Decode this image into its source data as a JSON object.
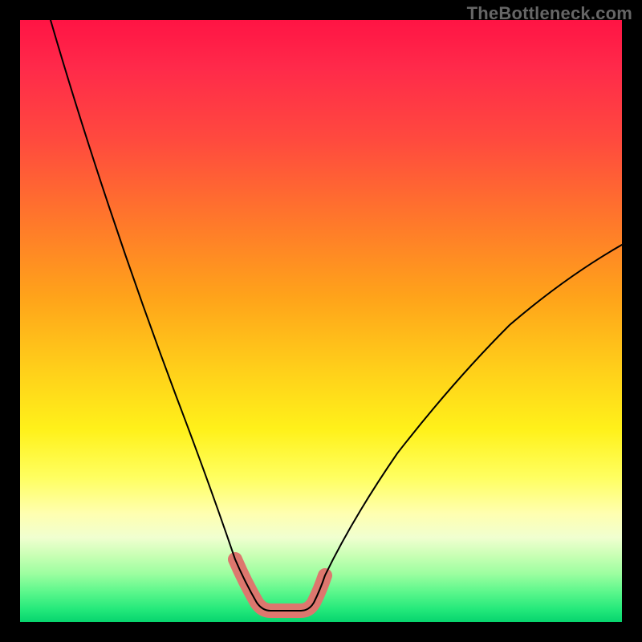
{
  "watermark": "TheBottleneck.com",
  "colors": {
    "background": "#000000",
    "curve_stroke": "#000000",
    "highlight_stroke": "#dd776e",
    "gradient_top": "#ff1444",
    "gradient_bottom": "#07d46e"
  },
  "chart_data": {
    "type": "line",
    "title": "",
    "xlabel": "",
    "ylabel": "",
    "xlim": [
      0,
      100
    ],
    "ylim": [
      0,
      100
    ],
    "note": "y≈100 at x≈5, drops to a flat minimum y≈2 around x≈40–48, then rises to y≈58 at x=100; highlighted segment marks the bottleneck region near the minimum.",
    "series": [
      {
        "name": "bottleneck-curve",
        "x": [
          5,
          10,
          15,
          20,
          25,
          30,
          35,
          38,
          40,
          42,
          44,
          46,
          48,
          52,
          58,
          65,
          72,
          80,
          88,
          94,
          100
        ],
        "y": [
          100,
          84,
          69,
          55,
          42,
          30,
          18,
          10,
          5,
          2,
          2,
          2,
          4,
          8,
          14,
          22,
          30,
          38,
          46,
          52,
          58
        ]
      }
    ],
    "highlight_range": {
      "x_start": 36,
      "x_end": 50
    }
  }
}
